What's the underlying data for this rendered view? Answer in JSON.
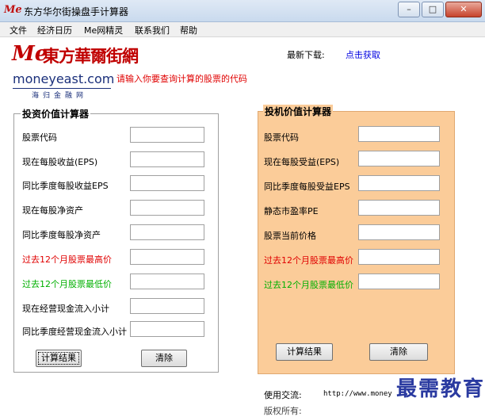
{
  "window": {
    "icon_text": "Me",
    "title": "东方华尔街操盘手计算器",
    "controls": [
      "–",
      "□",
      "✕"
    ]
  },
  "menu": [
    "文件",
    "经济日历",
    "Me网精灵",
    "联系我们",
    "帮助"
  ],
  "logo": {
    "me": "Me",
    "cn": "東方華爾街網",
    "site": "moneyeast.com",
    "tag": "海归金融网"
  },
  "prompt": "请输入你要查询计算的股票的代码",
  "download": {
    "label": "最新下载:",
    "link": "点击获取"
  },
  "left_panel": {
    "title": "投资价值计算器",
    "fields": [
      {
        "label": "股票代码",
        "value": ""
      },
      {
        "label": "现在每股收益(EPS)",
        "value": ""
      },
      {
        "label": "同比季度每股收益EPS",
        "value": ""
      },
      {
        "label": "现在每股净资产",
        "value": ""
      },
      {
        "label": "同比季度每股净资产",
        "value": ""
      },
      {
        "label": "过去12个月股票最高价",
        "value": ""
      },
      {
        "label": "过去12个月股票最低价",
        "value": ""
      },
      {
        "label": "现在经营现金流入小计",
        "value": ""
      },
      {
        "label": "同比季度经营现金流入小计",
        "value": ""
      }
    ],
    "calc_label": "计算结果",
    "clear_label": "清除"
  },
  "right_panel": {
    "title": "投机价值计算器",
    "fields": [
      {
        "label": "股票代码",
        "value": ""
      },
      {
        "label": "现在每股受益(EPS)",
        "value": ""
      },
      {
        "label": "同比季度每股受益EPS",
        "value": ""
      },
      {
        "label": "静态市盈率PE",
        "value": ""
      },
      {
        "label": "股票当前价格",
        "value": ""
      },
      {
        "label": "过去12个月股票最高价",
        "value": ""
      },
      {
        "label": "过去12个月股票最低价",
        "value": ""
      }
    ],
    "calc_label": "计算结果",
    "clear_label": "清除"
  },
  "footer": {
    "contact_label": "使用交流:",
    "contact_url": "http://www.money",
    "copyright": "版权所有:"
  },
  "watermark": "最需教育",
  "colors": {
    "right_panel_bg": "#fbcc99",
    "red_label": "#e00000",
    "green_label": "#00b000",
    "link": "#0000e0"
  }
}
